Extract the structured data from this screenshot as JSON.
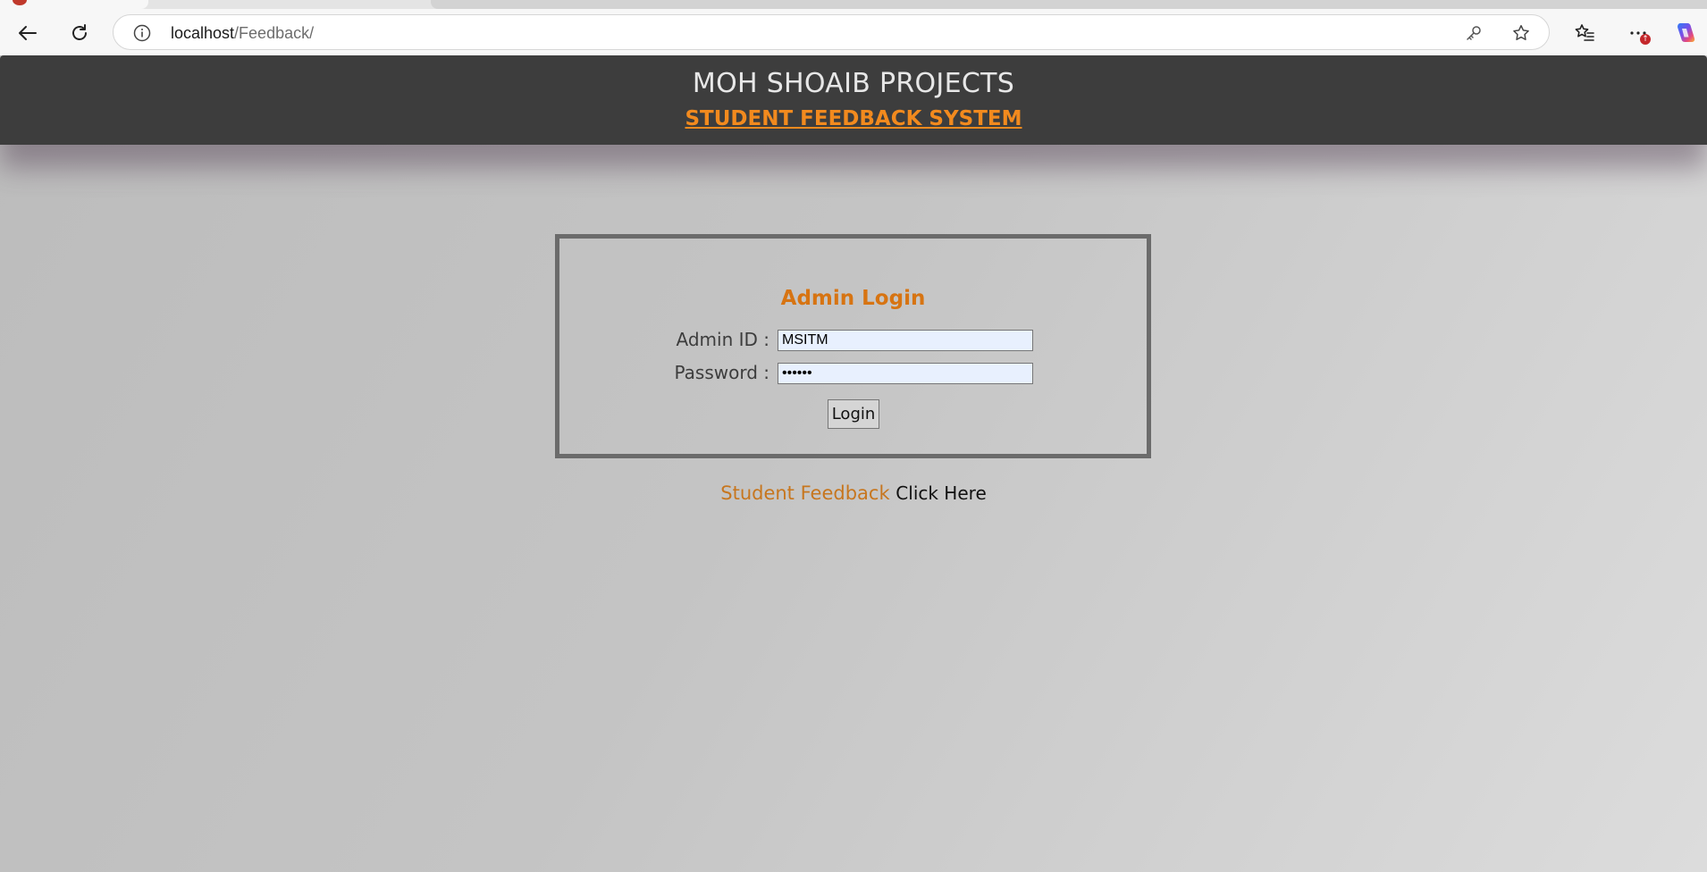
{
  "browser": {
    "url_host": "localhost",
    "url_path": "/Feedback/",
    "icons": {
      "back": "back-arrow-icon",
      "reload": "reload-icon",
      "info": "info-icon",
      "passwords": "key-icon",
      "favorite": "star-icon",
      "favorites_list": "favorites-list-icon",
      "menu": "more-icon",
      "copilot": "copilot-icon"
    },
    "badge_color": "#c4272b"
  },
  "header": {
    "title": "MOH SHOAIB PROJECTS",
    "subtitle": "STUDENT FEEDBACK SYSTEM",
    "background": "#3d3d3d",
    "subtitle_color": "#f28a1e"
  },
  "login": {
    "heading": "Admin Login",
    "admin_id_label": "Admin ID :",
    "admin_id_value": "MSITM",
    "password_label": "Password :",
    "password_value": "••••••",
    "submit_label": "Login",
    "accent": "#d77412"
  },
  "footer": {
    "prompt": "Student Feedback",
    "link_label": "Click Here"
  }
}
